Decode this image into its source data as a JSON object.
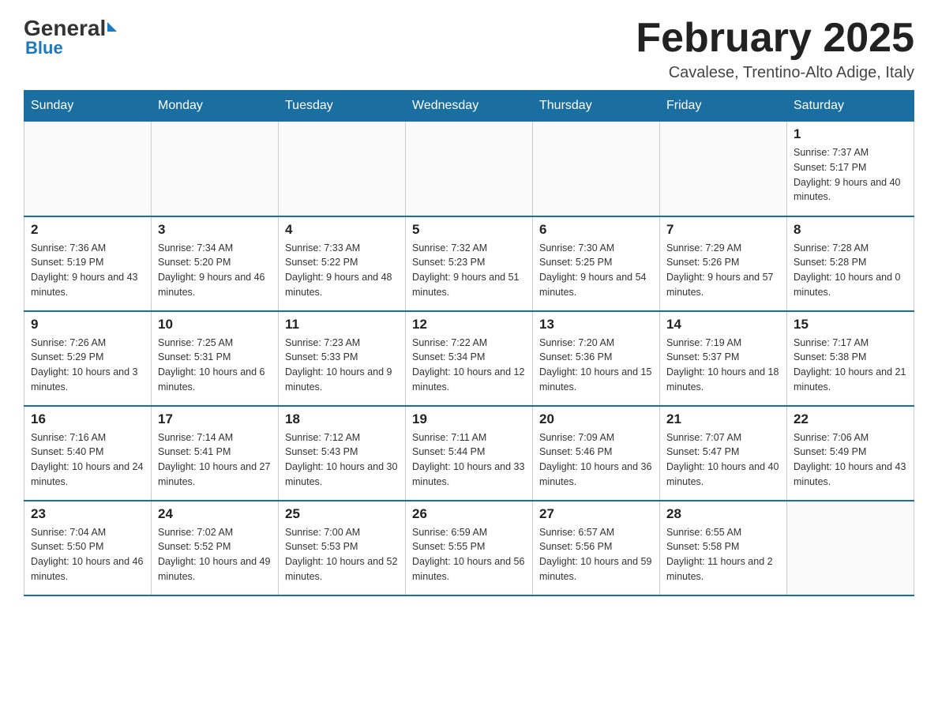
{
  "header": {
    "logo": {
      "general": "General",
      "blue": "Blue"
    },
    "title": "February 2025",
    "subtitle": "Cavalese, Trentino-Alto Adige, Italy"
  },
  "weekdays": [
    "Sunday",
    "Monday",
    "Tuesday",
    "Wednesday",
    "Thursday",
    "Friday",
    "Saturday"
  ],
  "weeks": [
    [
      {
        "day": "",
        "info": ""
      },
      {
        "day": "",
        "info": ""
      },
      {
        "day": "",
        "info": ""
      },
      {
        "day": "",
        "info": ""
      },
      {
        "day": "",
        "info": ""
      },
      {
        "day": "",
        "info": ""
      },
      {
        "day": "1",
        "info": "Sunrise: 7:37 AM\nSunset: 5:17 PM\nDaylight: 9 hours and 40 minutes."
      }
    ],
    [
      {
        "day": "2",
        "info": "Sunrise: 7:36 AM\nSunset: 5:19 PM\nDaylight: 9 hours and 43 minutes."
      },
      {
        "day": "3",
        "info": "Sunrise: 7:34 AM\nSunset: 5:20 PM\nDaylight: 9 hours and 46 minutes."
      },
      {
        "day": "4",
        "info": "Sunrise: 7:33 AM\nSunset: 5:22 PM\nDaylight: 9 hours and 48 minutes."
      },
      {
        "day": "5",
        "info": "Sunrise: 7:32 AM\nSunset: 5:23 PM\nDaylight: 9 hours and 51 minutes."
      },
      {
        "day": "6",
        "info": "Sunrise: 7:30 AM\nSunset: 5:25 PM\nDaylight: 9 hours and 54 minutes."
      },
      {
        "day": "7",
        "info": "Sunrise: 7:29 AM\nSunset: 5:26 PM\nDaylight: 9 hours and 57 minutes."
      },
      {
        "day": "8",
        "info": "Sunrise: 7:28 AM\nSunset: 5:28 PM\nDaylight: 10 hours and 0 minutes."
      }
    ],
    [
      {
        "day": "9",
        "info": "Sunrise: 7:26 AM\nSunset: 5:29 PM\nDaylight: 10 hours and 3 minutes."
      },
      {
        "day": "10",
        "info": "Sunrise: 7:25 AM\nSunset: 5:31 PM\nDaylight: 10 hours and 6 minutes."
      },
      {
        "day": "11",
        "info": "Sunrise: 7:23 AM\nSunset: 5:33 PM\nDaylight: 10 hours and 9 minutes."
      },
      {
        "day": "12",
        "info": "Sunrise: 7:22 AM\nSunset: 5:34 PM\nDaylight: 10 hours and 12 minutes."
      },
      {
        "day": "13",
        "info": "Sunrise: 7:20 AM\nSunset: 5:36 PM\nDaylight: 10 hours and 15 minutes."
      },
      {
        "day": "14",
        "info": "Sunrise: 7:19 AM\nSunset: 5:37 PM\nDaylight: 10 hours and 18 minutes."
      },
      {
        "day": "15",
        "info": "Sunrise: 7:17 AM\nSunset: 5:38 PM\nDaylight: 10 hours and 21 minutes."
      }
    ],
    [
      {
        "day": "16",
        "info": "Sunrise: 7:16 AM\nSunset: 5:40 PM\nDaylight: 10 hours and 24 minutes."
      },
      {
        "day": "17",
        "info": "Sunrise: 7:14 AM\nSunset: 5:41 PM\nDaylight: 10 hours and 27 minutes."
      },
      {
        "day": "18",
        "info": "Sunrise: 7:12 AM\nSunset: 5:43 PM\nDaylight: 10 hours and 30 minutes."
      },
      {
        "day": "19",
        "info": "Sunrise: 7:11 AM\nSunset: 5:44 PM\nDaylight: 10 hours and 33 minutes."
      },
      {
        "day": "20",
        "info": "Sunrise: 7:09 AM\nSunset: 5:46 PM\nDaylight: 10 hours and 36 minutes."
      },
      {
        "day": "21",
        "info": "Sunrise: 7:07 AM\nSunset: 5:47 PM\nDaylight: 10 hours and 40 minutes."
      },
      {
        "day": "22",
        "info": "Sunrise: 7:06 AM\nSunset: 5:49 PM\nDaylight: 10 hours and 43 minutes."
      }
    ],
    [
      {
        "day": "23",
        "info": "Sunrise: 7:04 AM\nSunset: 5:50 PM\nDaylight: 10 hours and 46 minutes."
      },
      {
        "day": "24",
        "info": "Sunrise: 7:02 AM\nSunset: 5:52 PM\nDaylight: 10 hours and 49 minutes."
      },
      {
        "day": "25",
        "info": "Sunrise: 7:00 AM\nSunset: 5:53 PM\nDaylight: 10 hours and 52 minutes."
      },
      {
        "day": "26",
        "info": "Sunrise: 6:59 AM\nSunset: 5:55 PM\nDaylight: 10 hours and 56 minutes."
      },
      {
        "day": "27",
        "info": "Sunrise: 6:57 AM\nSunset: 5:56 PM\nDaylight: 10 hours and 59 minutes."
      },
      {
        "day": "28",
        "info": "Sunrise: 6:55 AM\nSunset: 5:58 PM\nDaylight: 11 hours and 2 minutes."
      },
      {
        "day": "",
        "info": ""
      }
    ]
  ]
}
